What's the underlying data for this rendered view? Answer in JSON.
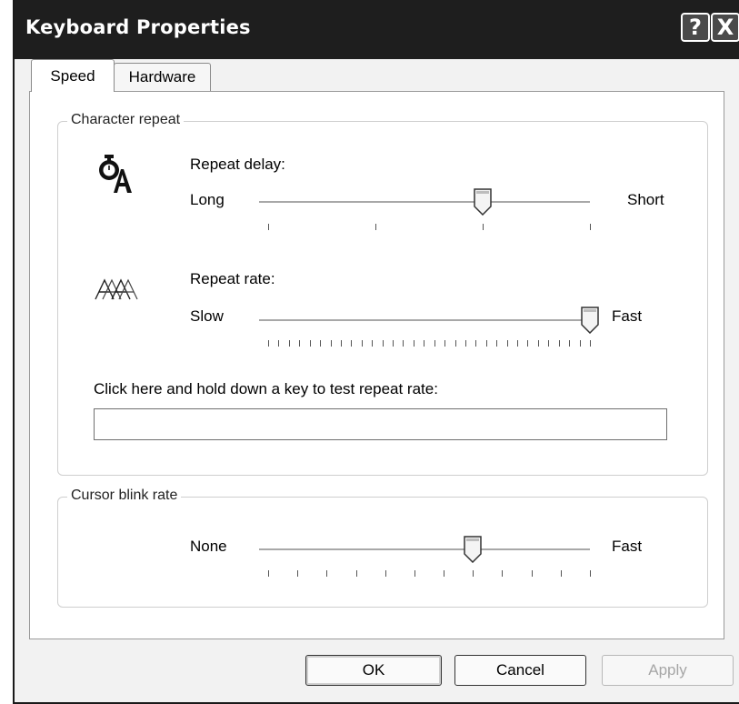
{
  "window": {
    "title": "Keyboard Properties",
    "help_label": "?",
    "close_label": "X"
  },
  "tabs": [
    {
      "label": "Speed",
      "selected": true
    },
    {
      "label": "Hardware",
      "selected": false
    }
  ],
  "character_repeat": {
    "legend": "Character repeat",
    "repeat_delay": {
      "label": "Repeat delay:",
      "min_label": "Long",
      "max_label": "Short",
      "tick_count": 4,
      "value_index": 2,
      "icon": "stopwatch-icon"
    },
    "repeat_rate": {
      "label": "Repeat rate:",
      "min_label": "Slow",
      "max_label": "Fast",
      "tick_count": 32,
      "value_index": 31,
      "icon": "repeat-rate-icon"
    },
    "test_prompt": "Click here and hold down a key to test repeat rate:",
    "test_value": ""
  },
  "cursor_blink": {
    "legend": "Cursor blink rate",
    "min_label": "None",
    "max_label": "Fast",
    "tick_count": 12,
    "value_index": 7
  },
  "buttons": {
    "ok": "OK",
    "cancel": "Cancel",
    "apply": "Apply",
    "apply_enabled": false
  }
}
